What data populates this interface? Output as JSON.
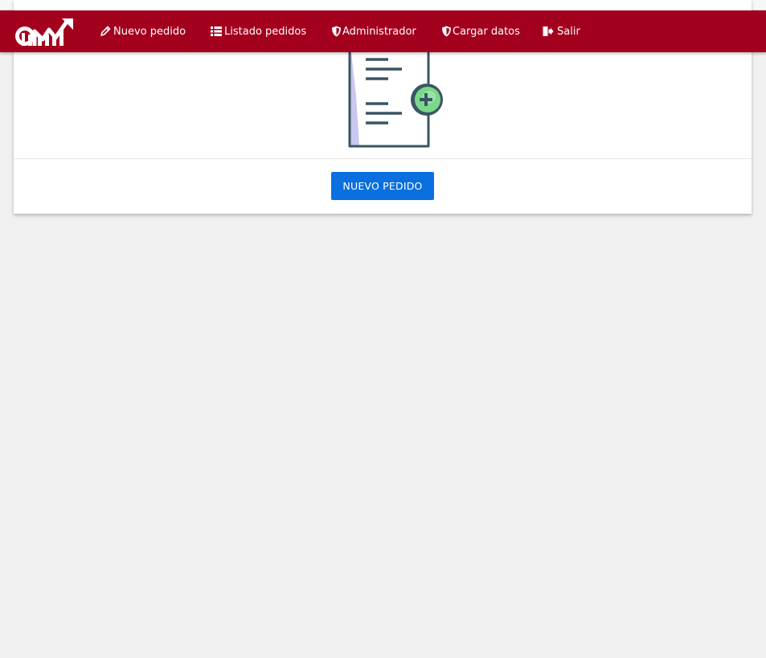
{
  "navbar": {
    "logo_label": "logo",
    "items": [
      {
        "label": "Nuevo pedido",
        "icon": "pencil-icon"
      },
      {
        "label": "Listado pedidos",
        "icon": "list-icon"
      },
      {
        "label": "Administrador",
        "icon": "shield-icon"
      },
      {
        "label": "Cargar datos",
        "icon": "shield-icon"
      },
      {
        "label": "Salir",
        "icon": "sign-out-icon"
      }
    ]
  },
  "main": {
    "illustration_icon": "document-add-icon",
    "button_label": "NUEVO PEDIDO"
  },
  "colors": {
    "navbar_bg": "#a3001e",
    "button_bg": "#0a6fdf",
    "page_bg": "#f0f0f0"
  }
}
